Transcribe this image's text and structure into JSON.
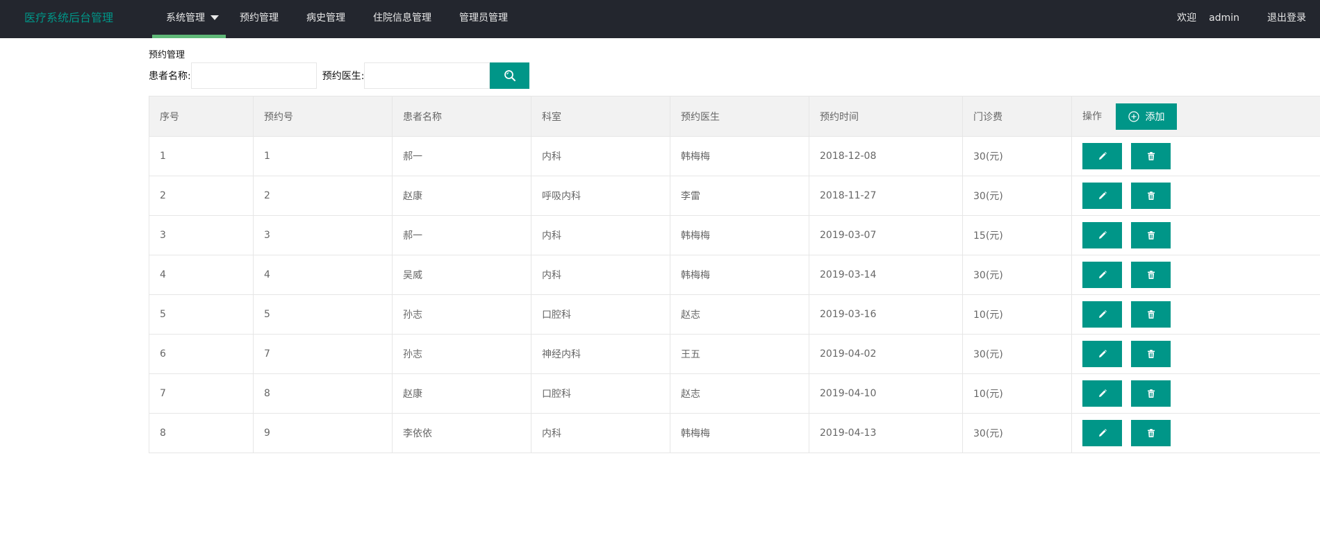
{
  "header": {
    "logo": "医疗系统后台管理",
    "nav": [
      {
        "label": "系统管理",
        "active": true,
        "dropdown": true
      },
      {
        "label": "预约管理"
      },
      {
        "label": "病史管理"
      },
      {
        "label": "住院信息管理"
      },
      {
        "label": "管理员管理"
      }
    ],
    "welcome": "欢迎",
    "username": "admin",
    "logout": "退出登录"
  },
  "search": {
    "section_title": "预约管理",
    "patient_label": "患者名称:",
    "patient_value": "",
    "doctor_label": "预约医生:",
    "doctor_value": "",
    "search_icon": "search-icon"
  },
  "table": {
    "headers": [
      "序号",
      "预约号",
      "患者名称",
      "科室",
      "预约医生",
      "预约时间",
      "门诊费",
      "操作"
    ],
    "add_label": "添加",
    "rows": [
      {
        "index": "1",
        "appt_no": "1",
        "patient": "郝一",
        "dept": "内科",
        "doctor": "韩梅梅",
        "time": "2018-12-08",
        "fee": "30(元)"
      },
      {
        "index": "2",
        "appt_no": "2",
        "patient": "赵康",
        "dept": "呼吸内科",
        "doctor": "李雷",
        "time": "2018-11-27",
        "fee": "30(元)"
      },
      {
        "index": "3",
        "appt_no": "3",
        "patient": "郝一",
        "dept": "内科",
        "doctor": "韩梅梅",
        "time": "2019-03-07",
        "fee": "15(元)"
      },
      {
        "index": "4",
        "appt_no": "4",
        "patient": "吴威",
        "dept": "内科",
        "doctor": "韩梅梅",
        "time": "2019-03-14",
        "fee": "30(元)"
      },
      {
        "index": "5",
        "appt_no": "5",
        "patient": "孙志",
        "dept": "口腔科",
        "doctor": "赵志",
        "time": "2019-03-16",
        "fee": "10(元)"
      },
      {
        "index": "6",
        "appt_no": "7",
        "patient": "孙志",
        "dept": "神经内科",
        "doctor": "王五",
        "time": "2019-04-02",
        "fee": "30(元)"
      },
      {
        "index": "7",
        "appt_no": "8",
        "patient": "赵康",
        "dept": "口腔科",
        "doctor": "赵志",
        "time": "2019-04-10",
        "fee": "10(元)"
      },
      {
        "index": "8",
        "appt_no": "9",
        "patient": "李依依",
        "dept": "内科",
        "doctor": "韩梅梅",
        "time": "2019-04-13",
        "fee": "30(元)"
      }
    ]
  },
  "colors": {
    "header_bg": "#23262e",
    "accent": "#009688",
    "nav_active": "#5fb878"
  }
}
